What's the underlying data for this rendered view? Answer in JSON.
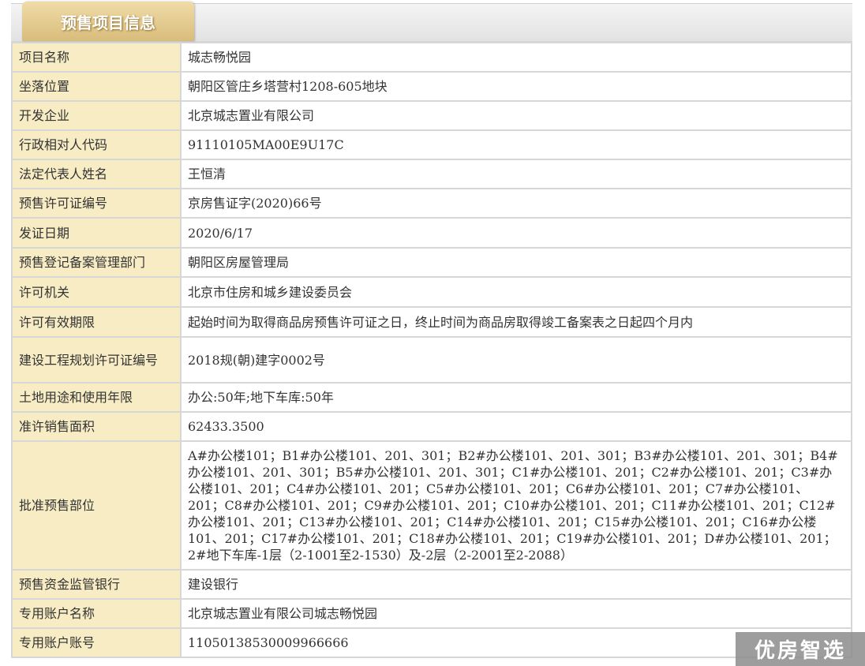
{
  "header": {
    "tab_title": "预售项目信息"
  },
  "rows": [
    {
      "label": "项目名称",
      "value": "城志畅悦园"
    },
    {
      "label": "坐落位置",
      "value": "朝阳区管庄乡塔营村1208-605地块"
    },
    {
      "label": "开发企业",
      "value": "北京城志置业有限公司"
    },
    {
      "label": "行政相对人代码",
      "value": "91110105MA00E9U17C"
    },
    {
      "label": "法定代表人姓名",
      "value": "王恒清"
    },
    {
      "label": "预售许可证编号",
      "value": "京房售证字(2020)66号"
    },
    {
      "label": "发证日期",
      "value": "2020/6/17"
    },
    {
      "label": "预售登记备案管理部门",
      "value": "朝阳区房屋管理局"
    },
    {
      "label": "许可机关",
      "value": "北京市住房和城乡建设委员会"
    },
    {
      "label": "许可有效期限",
      "value": "起始时间为取得商品房预售许可证之日，终止时间为商品房取得竣工备案表之日起四个月内"
    },
    {
      "label": "建设工程规划许可证编号",
      "value": "2018规(朝)建字0002号"
    },
    {
      "label": "土地用途和使用年限",
      "value": "办公:50年;地下车库:50年"
    },
    {
      "label": "准许销售面积",
      "value": "62433.3500"
    },
    {
      "label": "批准预售部位",
      "value": "A#办公楼101；B1#办公楼101、201、301；B2#办公楼101、201、301；B3#办公楼101、201、301；B4#办公楼101、201、301；B5#办公楼101、201、301；C1#办公楼101、201；C2#办公楼101、201；C3#办公楼101、201；C4#办公楼101、201；C5#办公楼101、201；C6#办公楼101、201；C7#办公楼101、201；C8#办公楼101、201；C9#办公楼101、201；C10#办公楼101、201；C11#办公楼101、201；C12#办公楼101、201；C13#办公楼101、201；C14#办公楼101、201；C15#办公楼101、201；C16#办公楼101、201；C17#办公楼101、201；C18#办公楼101、201；C19#办公楼101、201；D#办公楼101、201；2#地下车库-1层（2-1001至2-1530）及-2层（2-2001至2-2088）"
    },
    {
      "label": "预售资金监管银行",
      "value": "建设银行"
    },
    {
      "label": "专用账户名称",
      "value": "北京城志置业有限公司城志畅悦园"
    },
    {
      "label": "专用账户账号",
      "value": "11050138530009966666"
    }
  ],
  "watermark": {
    "text": "优房智选"
  }
}
